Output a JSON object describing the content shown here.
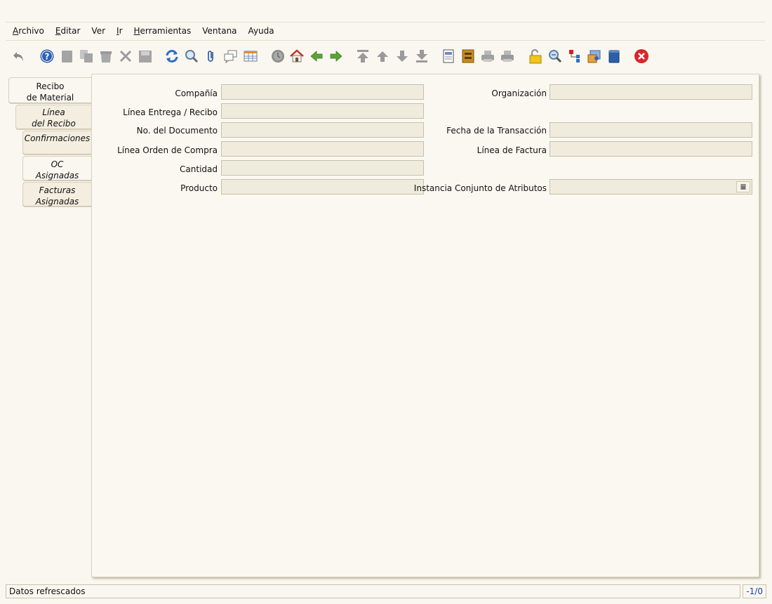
{
  "menu": {
    "items": [
      {
        "mnemonic": "A",
        "rest": "rchivo"
      },
      {
        "mnemonic": "E",
        "rest": "ditar"
      },
      {
        "mnemonic": "",
        "rest": "Ver"
      },
      {
        "mnemonic": "I",
        "rest": "r"
      },
      {
        "mnemonic": "H",
        "rest": "erramientas"
      },
      {
        "mnemonic": "",
        "rest": "Ventana"
      },
      {
        "mnemonic": "",
        "rest": "Ayuda"
      }
    ]
  },
  "toolbar": {
    "icons": [
      "undo-icon",
      "help-icon",
      "new-record-icon",
      "copy-record-icon",
      "delete-icon",
      "delete-selection-icon",
      "save-icon",
      "refresh-icon",
      "find-icon",
      "attachment-icon",
      "chat-icon",
      "grid-toggle-icon",
      "history-icon",
      "home-icon",
      "back-icon",
      "forward-icon",
      "first-record-icon",
      "previous-record-icon",
      "next-record-icon",
      "last-record-icon",
      "report-icon",
      "archive-icon",
      "print-preview-icon",
      "print-icon",
      "lock-icon",
      "zoom-across-icon",
      "workflow-icon",
      "request-icon",
      "product-info-icon",
      "close-window-icon"
    ]
  },
  "tabs": [
    {
      "line1": "Recibo",
      "line2": "de Material"
    },
    {
      "line1": "Línea",
      "line2": "del Recibo"
    },
    {
      "line1": "Confirmaciones",
      "line2": ""
    },
    {
      "line1": "OC",
      "line2": "Asignadas"
    },
    {
      "line1": "Facturas",
      "line2": "Asignadas"
    }
  ],
  "form": {
    "company_label": "Compañía",
    "company_value": "",
    "organization_label": "Organización",
    "organization_value": "",
    "shipment_line_label": "Línea Entrega / Recibo",
    "shipment_line_value": "",
    "document_no_label": "No. del Documento",
    "document_no_value": "",
    "transaction_date_label": "Fecha de la Transacción",
    "transaction_date_value": "",
    "po_line_label": "Línea Orden de Compra",
    "po_line_value": "",
    "invoice_line_label": "Línea de Factura",
    "invoice_line_value": "",
    "quantity_label": "Cantidad",
    "quantity_value": "",
    "product_label": "Producto",
    "product_value": "",
    "attribute_set_label": "Instancia Conjunto de Atributos",
    "attribute_set_value": ""
  },
  "status": {
    "message": "Datos refrescados",
    "record_indicator": "-1/0"
  },
  "colors": {
    "background": "#faf7f0",
    "field_bg": "#f0ecdd",
    "record_indicator": "#1a3fa8",
    "close_red": "#d9262b"
  }
}
